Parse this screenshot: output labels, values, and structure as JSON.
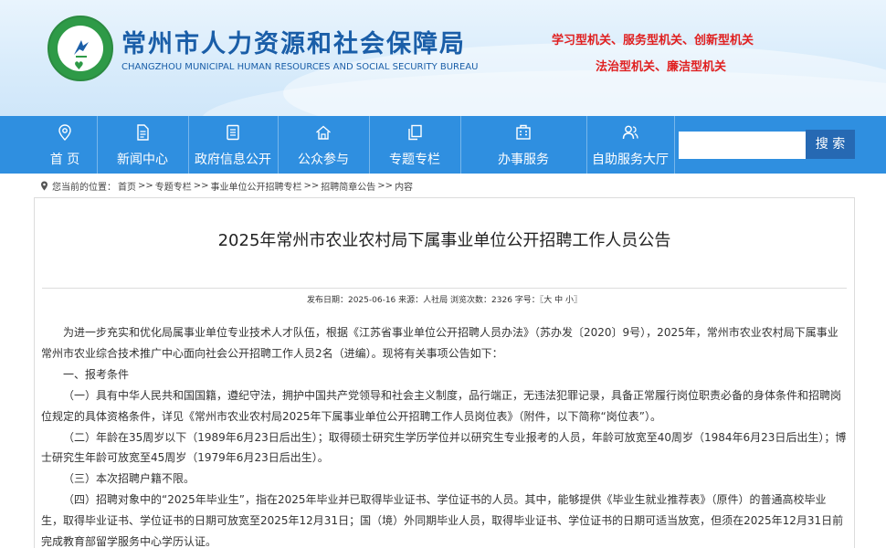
{
  "header": {
    "title": "常州市人力资源和社会保障局",
    "subtitle": "CHANGZHOU MUNICIPAL HUMAN RESOURCES AND SOCIAL SECURITY BUREAU",
    "slogan_line1": "学习型机关、服务型机关、创新型机关",
    "slogan_line2": "法治型机关、廉洁型机关"
  },
  "nav": {
    "items": [
      {
        "label": "首 页",
        "icon": "location-pin-icon"
      },
      {
        "label": "新闻中心",
        "icon": "document-icon"
      },
      {
        "label": "政府信息公开",
        "icon": "list-icon"
      },
      {
        "label": "公众参与",
        "icon": "house-icon"
      },
      {
        "label": "专题专栏",
        "icon": "copy-icon"
      },
      {
        "label": "办事服务",
        "icon": "building-icon"
      },
      {
        "label": "自助服务大厅",
        "icon": "users-icon"
      }
    ],
    "search_placeholder": "",
    "search_button": "搜 索"
  },
  "breadcrumb": {
    "prefix": "您当前的位置：",
    "items": [
      "首页",
      "专题专栏",
      "事业单位公开招聘专栏",
      "招聘简章公告",
      "内容"
    ],
    "separator": ">>"
  },
  "article": {
    "title": "2025年常州市农业农村局下属事业单位公开招聘工作人员公告",
    "meta": "发布日期：2025-06-16   来源：人社局   浏览次数：2326 字号：〖大 中 小〗",
    "paragraphs": [
      "为进一步充实和优化局属事业单位专业技术人才队伍，根据《江苏省事业单位公开招聘人员办法》（苏办发〔2020〕9号），2025年，常州市农业农村局下属事业常州市农业综合技术推广中心面向社会公开招聘工作人员2名（进编）。现将有关事项公告如下：",
      "一、报考条件",
      "（一）具有中华人民共和国国籍，遵纪守法，拥护中国共产党领导和社会主义制度，品行端正，无违法犯罪记录，具备正常履行岗位职责必备的身体条件和招聘岗位规定的具体资格条件，详见《常州市农业农村局2025年下属事业单位公开招聘工作人员岗位表》（附件，以下简称“岗位表”）。",
      "（二）年龄在35周岁以下（1989年6月23日后出生）；取得硕士研究生学历学位并以研究生专业报考的人员，年龄可放宽至40周岁（1984年6月23日后出生）；博士研究生年龄可放宽至45周岁（1979年6月23日后出生）。",
      "（三）本次招聘户籍不限。",
      "（四）招聘对象中的“2025年毕业生”，指在2025年毕业并已取得毕业证书、学位证书的人员。其中，能够提供《毕业生就业推荐表》（原件）的普通高校毕业生，取得毕业证书、学位证书的日期可放宽至2025年12月31日；国（境）外同期毕业人员，取得毕业证书、学位证书的日期可适当放宽，但须在2025年12月31日前完成教育部留学服务中心学历认证。"
    ]
  },
  "colors": {
    "nav_bg": "#2f8fe0",
    "title_blue": "#1a5ea8",
    "slogan_red": "#e02020",
    "logo_green": "#2e9a47"
  }
}
